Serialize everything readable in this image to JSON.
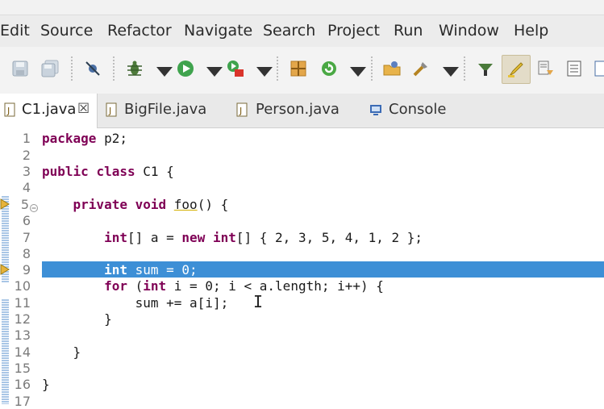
{
  "menubar": {
    "items": [
      "Edit",
      "Source",
      "Refactor",
      "Navigate",
      "Search",
      "Project",
      "Run",
      "Window",
      "Help"
    ]
  },
  "toolbar": {
    "icons": [
      "save-icon",
      "save-all-icon",
      "skip-breakpoints-icon",
      "debug-icon",
      "run-icon",
      "run-configurations-icon",
      "new-class-icon",
      "refresh-icon",
      "open-type-icon",
      "tools-icon",
      "toggle-mark-occurrences-icon",
      "highlight-icon",
      "history-icon",
      "console-view-icon"
    ]
  },
  "tabs": [
    {
      "label": "C1.java",
      "active": true,
      "icon": "java-file-icon",
      "close": "☒"
    },
    {
      "label": "BigFile.java",
      "active": false,
      "icon": "java-file-icon"
    },
    {
      "label": "Person.java",
      "active": false,
      "icon": "java-file-icon"
    },
    {
      "label": "Console",
      "active": false,
      "icon": "console-icon"
    }
  ],
  "editor": {
    "line_numbers": [
      "1",
      "2",
      "3",
      "4",
      "5",
      "6",
      "7",
      "8",
      "9",
      "10",
      "11",
      "12",
      "13",
      "14",
      "15",
      "16",
      "17"
    ],
    "selected_line": 9,
    "lines": [
      "package p2;",
      "",
      "public class C1 {",
      "",
      "    private void foo() {",
      "",
      "        int[] a = new int[] { 2, 3, 5, 4, 1, 2 };",
      "",
      "        int sum = 0;",
      "        for (int i = 0; i < a.length; i++) {",
      "            sum += a[i];",
      "        }",
      "",
      "    }",
      "",
      "}",
      ""
    ]
  },
  "colors": {
    "keyword": "#7f0055",
    "selection": "#3d8fd6",
    "line_number": "#7b7b7b"
  }
}
